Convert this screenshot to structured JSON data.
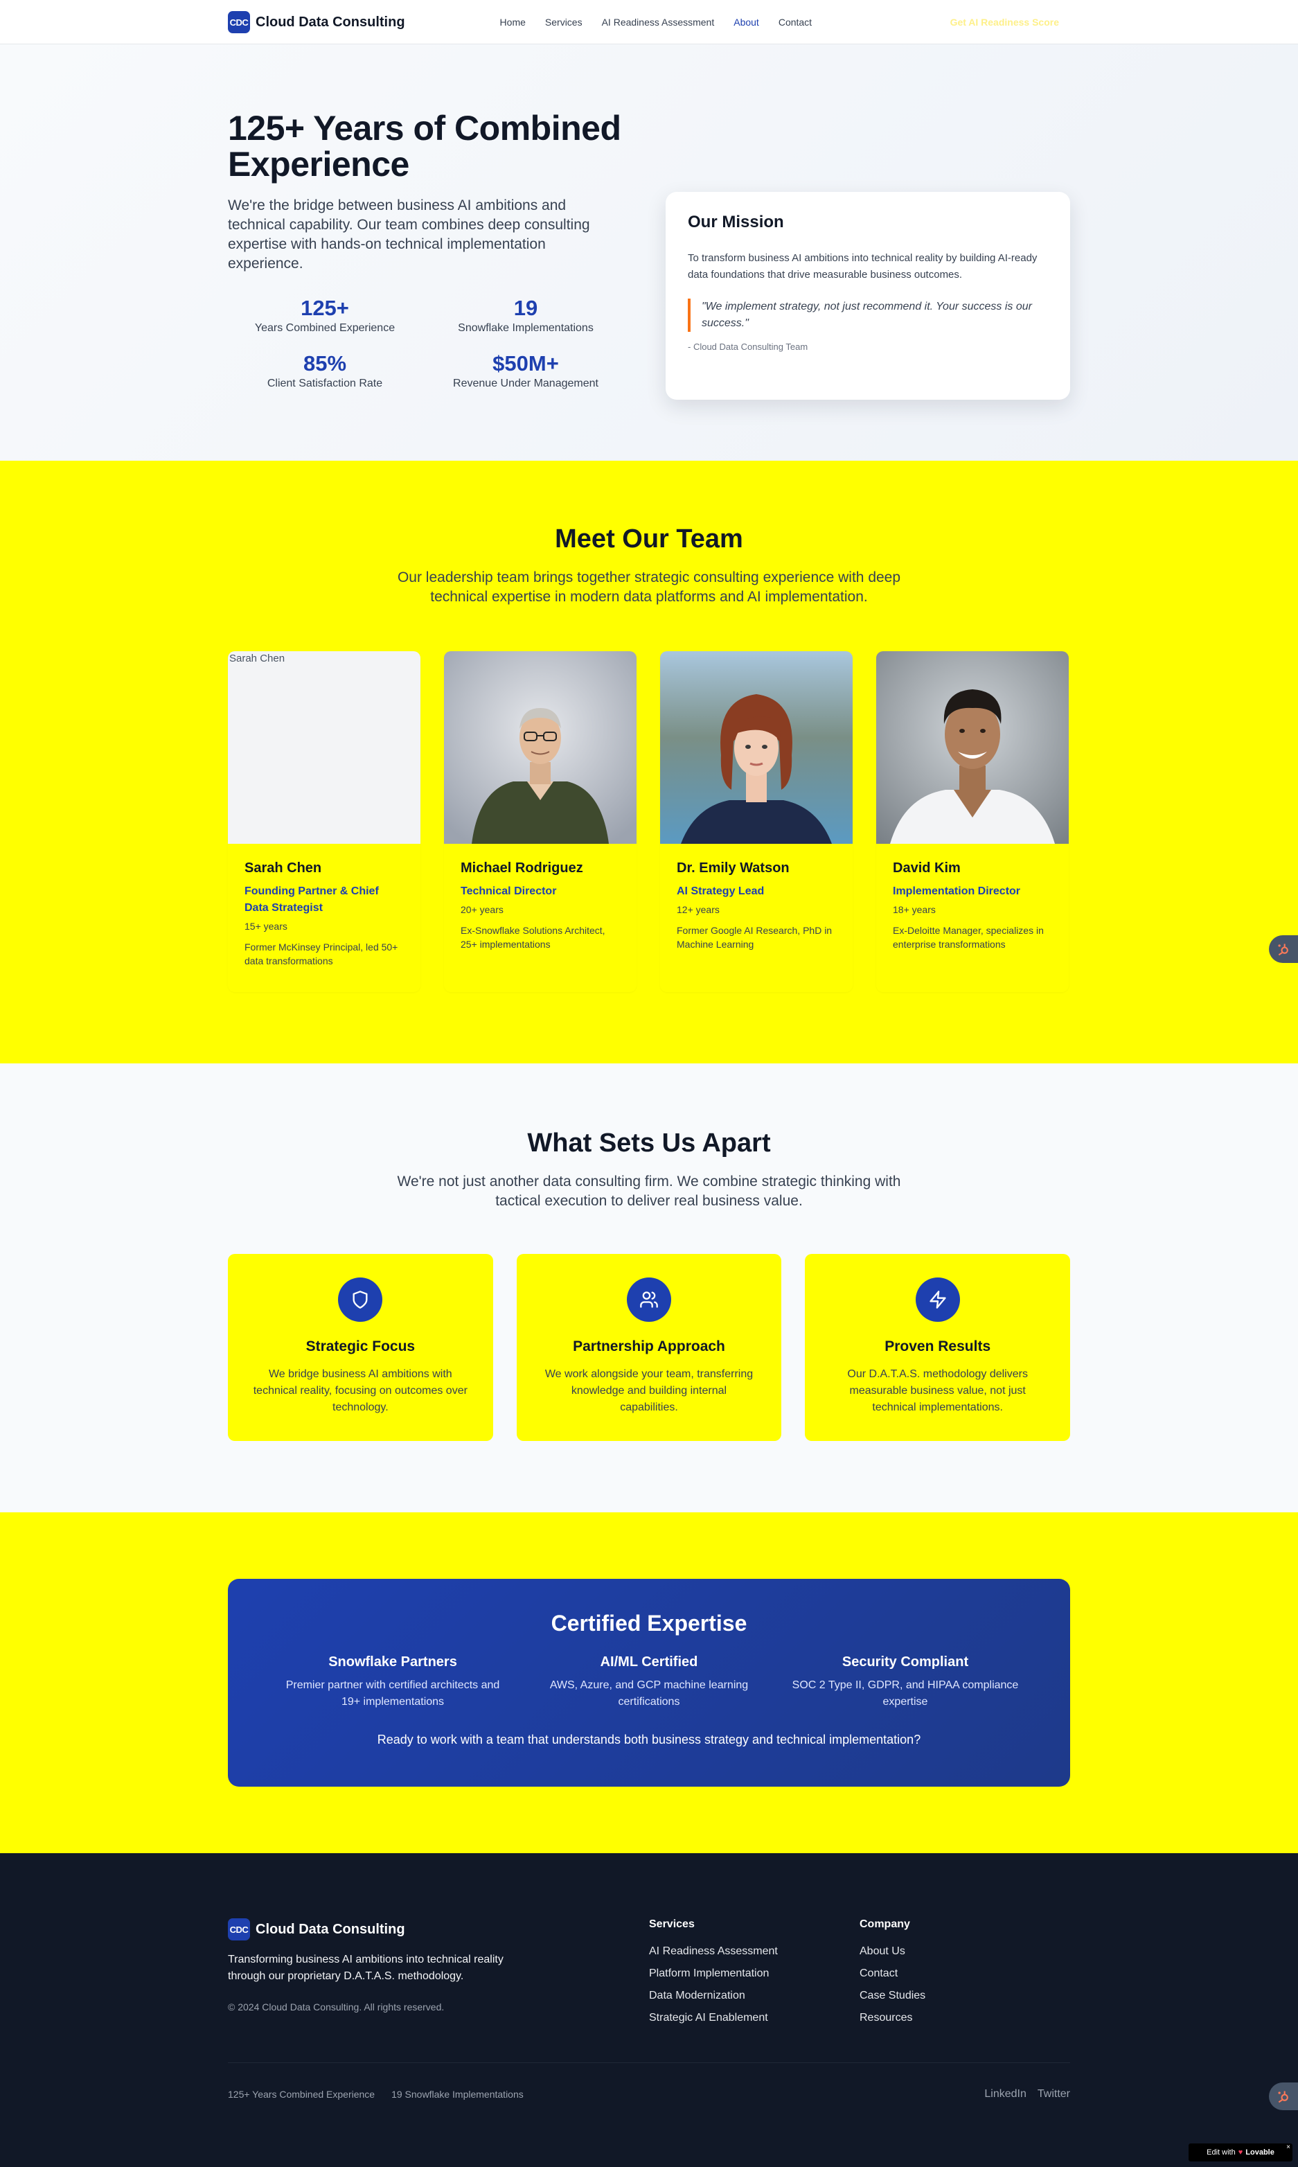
{
  "brand": {
    "badge": "CDC",
    "name": "Cloud Data Consulting"
  },
  "nav": {
    "links": [
      "Home",
      "Services",
      "AI Readiness Assessment",
      "About",
      "Contact"
    ],
    "active": "About",
    "cta": "Get AI Readiness Score"
  },
  "hero": {
    "title": "125+ Years of Combined Experience",
    "subtitle": "We're the bridge between business AI ambitions and technical capability. Our team combines deep consulting expertise with hands-on technical implementation experience.",
    "stats": [
      {
        "value": "125+",
        "label": "Years Combined Experience"
      },
      {
        "value": "19",
        "label": "Snowflake Implementations"
      },
      {
        "value": "85%",
        "label": "Client Satisfaction Rate"
      },
      {
        "value": "$50M+",
        "label": "Revenue Under Management"
      }
    ]
  },
  "mission": {
    "title": "Our Mission",
    "text": "To transform business AI ambitions into technical reality by building AI-ready data foundations that drive measurable business outcomes.",
    "quote": "\"We implement strategy, not just recommend it. Your success is our success.\"",
    "author": "- Cloud Data Consulting Team"
  },
  "team": {
    "title": "Meet Our Team",
    "subtitle": "Our leadership team brings together strategic consulting experience with deep technical expertise in modern data platforms and AI implementation.",
    "members": [
      {
        "name": "Sarah Chen",
        "role": "Founding Partner & Chief Data Strategist",
        "years": "15+ years",
        "bio": "Former McKinsey Principal, led 50+ data transformations",
        "photo_alt": "Sarah Chen"
      },
      {
        "name": "Michael Rodriguez",
        "role": "Technical Director",
        "years": "20+ years",
        "bio": "Ex-Snowflake Solutions Architect, 25+ implementations"
      },
      {
        "name": "Dr. Emily Watson",
        "role": "AI Strategy Lead",
        "years": "12+ years",
        "bio": "Former Google AI Research, PhD in Machine Learning"
      },
      {
        "name": "David Kim",
        "role": "Implementation Director",
        "years": "18+ years",
        "bio": "Ex-Deloitte Manager, specializes in enterprise transformations"
      }
    ]
  },
  "apart": {
    "title": "What Sets Us Apart",
    "subtitle": "We're not just another data consulting firm. We combine strategic thinking with tactical execution to deliver real business value.",
    "cards": [
      {
        "icon": "shield-icon",
        "title": "Strategic Focus",
        "text": "We bridge business AI ambitions with technical reality, focusing on outcomes over technology."
      },
      {
        "icon": "users-icon",
        "title": "Partnership Approach",
        "text": "We work alongside your team, transferring knowledge and building internal capabilities."
      },
      {
        "icon": "lightning-icon",
        "title": "Proven Results",
        "text": "Our D.A.T.A.S. methodology delivers measurable business value, not just technical implementations."
      }
    ]
  },
  "certified": {
    "title": "Certified Expertise",
    "cols": [
      {
        "title": "Snowflake Partners",
        "text": "Premier partner with certified architects and 19+ implementations"
      },
      {
        "title": "AI/ML Certified",
        "text": "AWS, Azure, and GCP machine learning certifications"
      },
      {
        "title": "Security Compliant",
        "text": "SOC 2 Type II, GDPR, and HIPAA compliance expertise"
      }
    ],
    "cta": "Ready to work with a team that understands both business strategy and technical implementation?"
  },
  "footer": {
    "description": "Transforming business AI ambitions into technical reality through our proprietary D.A.T.A.S. methodology.",
    "copyright": "© 2024 Cloud Data Consulting. All rights reserved.",
    "services_title": "Services",
    "services": [
      "AI Readiness Assessment",
      "Platform Implementation",
      "Data Modernization",
      "Strategic AI Enablement"
    ],
    "company_title": "Company",
    "company": [
      "About Us",
      "Contact",
      "Case Studies",
      "Resources"
    ],
    "bottom_stats": [
      "125+ Years Combined Experience",
      "19 Snowflake Implementations"
    ],
    "social": [
      "LinkedIn",
      "Twitter"
    ]
  },
  "lovable": {
    "prefix": "Edit with",
    "brand": "Lovable",
    "close": "×"
  },
  "colors": {
    "accent": "#1e40af",
    "yellow": "#ffff00",
    "footer_bg": "#111827",
    "quote_bar": "#f97316"
  }
}
